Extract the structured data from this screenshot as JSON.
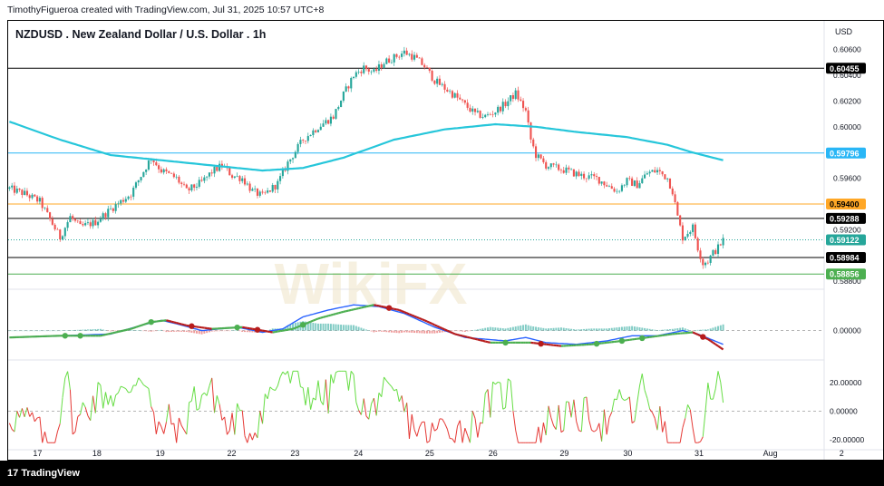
{
  "header": {
    "attribution": "TimothyFigueroa created with TradingView.com, Jul 31, 2025 10:57 UTC+8"
  },
  "chart_title": "NZDUSD . New Zealand Dollar / U.S. Dollar . 1h",
  "currency": "USD",
  "footer": {
    "brand": "TradingView",
    "brand_mark": "17"
  },
  "watermark": "WikiFX",
  "colors": {
    "up": "#26a69a",
    "down": "#ef5350",
    "ma": "#26c6da",
    "orange": "#ffa726",
    "black": "#000000",
    "green": "#4caf50",
    "macd_blue": "#2962ff",
    "macd_red": "#b71c1c",
    "rsi_green": "#66dd44",
    "rsi_red": "#e53935"
  },
  "chart_data": [
    {
      "type": "candlestick",
      "title": "NZDUSD . New Zealand Dollar / U.S. Dollar . 1h",
      "ylim": [
        0.5878,
        0.6064
      ],
      "x_ticks": [
        "17",
        "18",
        "19",
        "22",
        "23",
        "24",
        "25",
        "26",
        "29",
        "30",
        "31",
        "Aug",
        "2"
      ],
      "y_ticks": [
        "0.60600",
        "0.60400",
        "0.60200",
        "0.60000",
        "0.59800",
        "0.59600",
        "0.59400",
        "0.59200",
        "0.59000",
        "0.58800"
      ],
      "horizontal_lines": [
        {
          "value": 0.60455,
          "label": "0.60455",
          "color": "#000000",
          "style": "solid"
        },
        {
          "value": 0.59796,
          "label": "0.59796",
          "color": "#29b6f6",
          "style": "solid"
        },
        {
          "value": 0.594,
          "label": "0.59400",
          "color": "#ffa726",
          "style": "solid"
        },
        {
          "value": 0.59288,
          "label": "0.59288",
          "color": "#000000",
          "style": "solid"
        },
        {
          "value": 0.59122,
          "label": "0.59122",
          "color": "#26a69a",
          "style": "dotted"
        },
        {
          "value": 0.58984,
          "label": "0.58984",
          "color": "#000000",
          "style": "solid"
        },
        {
          "value": 0.58856,
          "label": "0.58856",
          "color": "#4caf50",
          "style": "solid"
        }
      ],
      "close_path": [
        [
          0,
          0.5952
        ],
        [
          6,
          0.5948
        ],
        [
          12,
          0.5942
        ],
        [
          16,
          0.5928
        ],
        [
          20,
          0.5914
        ],
        [
          24,
          0.593
        ],
        [
          28,
          0.5922
        ],
        [
          34,
          0.5926
        ],
        [
          40,
          0.5936
        ],
        [
          48,
          0.5948
        ],
        [
          52,
          0.5962
        ],
        [
          56,
          0.5976
        ],
        [
          60,
          0.5966
        ],
        [
          66,
          0.596
        ],
        [
          70,
          0.595
        ],
        [
          76,
          0.5957
        ],
        [
          80,
          0.5965
        ],
        [
          84,
          0.597
        ],
        [
          88,
          0.5962
        ],
        [
          92,
          0.596
        ],
        [
          96,
          0.595
        ],
        [
          100,
          0.5946
        ],
        [
          106,
          0.5956
        ],
        [
          110,
          0.5972
        ],
        [
          116,
          0.599
        ],
        [
          122,
          0.6
        ],
        [
          128,
          0.6008
        ],
        [
          132,
          0.6025
        ],
        [
          136,
          0.604
        ],
        [
          140,
          0.6046
        ],
        [
          144,
          0.6042
        ],
        [
          148,
          0.605
        ],
        [
          152,
          0.6054
        ],
        [
          156,
          0.6058
        ],
        [
          160,
          0.6054
        ],
        [
          164,
          0.6047
        ],
        [
          168,
          0.6036
        ],
        [
          172,
          0.603
        ],
        [
          176,
          0.6024
        ],
        [
          180,
          0.6017
        ],
        [
          184,
          0.601
        ],
        [
          188,
          0.6008
        ],
        [
          192,
          0.6012
        ],
        [
          196,
          0.6018
        ],
        [
          200,
          0.6026
        ],
        [
          204,
          0.6012
        ],
        [
          206,
          0.599
        ],
        [
          208,
          0.5978
        ],
        [
          212,
          0.597
        ],
        [
          216,
          0.5968
        ],
        [
          220,
          0.5966
        ],
        [
          226,
          0.5962
        ],
        [
          232,
          0.596
        ],
        [
          236,
          0.5955
        ],
        [
          240,
          0.595
        ],
        [
          244,
          0.5958
        ],
        [
          248,
          0.5955
        ],
        [
          252,
          0.5964
        ],
        [
          256,
          0.5966
        ],
        [
          260,
          0.596
        ],
        [
          262,
          0.595
        ],
        [
          264,
          0.593
        ],
        [
          266,
          0.5914
        ],
        [
          268,
          0.5918
        ],
        [
          270,
          0.5922
        ],
        [
          272,
          0.5906
        ],
        [
          274,
          0.5894
        ],
        [
          276,
          0.5896
        ],
        [
          278,
          0.5902
        ],
        [
          280,
          0.5906
        ],
        [
          282,
          0.5912
        ]
      ],
      "ma_path": [
        [
          0,
          0.6004
        ],
        [
          20,
          0.599
        ],
        [
          40,
          0.5978
        ],
        [
          60,
          0.5974
        ],
        [
          80,
          0.597
        ],
        [
          100,
          0.5966
        ],
        [
          116,
          0.5968
        ],
        [
          132,
          0.5976
        ],
        [
          152,
          0.599
        ],
        [
          172,
          0.5998
        ],
        [
          192,
          0.6002
        ],
        [
          208,
          0.6
        ],
        [
          224,
          0.5996
        ],
        [
          244,
          0.5992
        ],
        [
          260,
          0.5986
        ],
        [
          270,
          0.598
        ],
        [
          282,
          0.5974
        ]
      ],
      "n_bars": 283
    },
    {
      "type": "line",
      "name": "MACD",
      "ylim": [
        -0.0015,
        0.0022
      ],
      "y_ticks": [
        "0.00000"
      ],
      "series": [
        {
          "points": [
            [
              0,
              -0.0004
            ],
            [
              20,
              -0.0003
            ],
            [
              40,
              -0.0002
            ],
            [
              52,
              0.0003
            ],
            [
              60,
              0.0006
            ],
            [
              66,
              0.0004
            ],
            [
              76,
              0.0
            ],
            [
              90,
              0.0002
            ],
            [
              100,
              -0.0001
            ],
            [
              108,
              0.0001
            ],
            [
              116,
              0.0008
            ],
            [
              126,
              0.0012
            ],
            [
              136,
              0.0015
            ],
            [
              146,
              0.0014
            ],
            [
              156,
              0.001
            ],
            [
              168,
              0.0002
            ],
            [
              180,
              -0.0004
            ],
            [
              196,
              -0.0006
            ],
            [
              204,
              -0.0004
            ],
            [
              212,
              -0.0007
            ],
            [
              224,
              -0.0008
            ],
            [
              236,
              -0.0006
            ],
            [
              246,
              -0.0003
            ],
            [
              256,
              -0.0003
            ],
            [
              266,
              0.0
            ],
            [
              272,
              -0.0002
            ],
            [
              282,
              -0.0008
            ]
          ]
        },
        {
          "points": [
            [
              0,
              -0.0004
            ],
            [
              20,
              -0.0003
            ],
            [
              36,
              -0.0003
            ],
            [
              48,
              0.0001
            ],
            [
              56,
              0.0005
            ],
            [
              62,
              0.0006
            ],
            [
              70,
              0.0003
            ],
            [
              80,
              0.0001
            ],
            [
              92,
              0.0002
            ],
            [
              104,
              -0.0001
            ],
            [
              112,
              0.0001
            ],
            [
              122,
              0.0007
            ],
            [
              132,
              0.0011
            ],
            [
              144,
              0.0015
            ],
            [
              154,
              0.0012
            ],
            [
              164,
              0.0006
            ],
            [
              176,
              -0.0002
            ],
            [
              190,
              -0.0007
            ],
            [
              206,
              -0.0007
            ],
            [
              218,
              -0.0009
            ],
            [
              230,
              -0.0008
            ],
            [
              242,
              -0.0006
            ],
            [
              252,
              -0.0004
            ],
            [
              262,
              -0.0002
            ],
            [
              270,
              -0.0001
            ],
            [
              276,
              -0.0005
            ],
            [
              282,
              -0.0011
            ]
          ]
        }
      ],
      "signal_dots": [
        [
          22,
          -0.0002
        ],
        [
          28,
          -0.0002
        ],
        [
          56,
          0.0005
        ],
        [
          72,
          0.0002
        ],
        [
          90,
          0.0002
        ],
        [
          98,
          -0.0001
        ],
        [
          116,
          0.0007
        ],
        [
          150,
          0.0014
        ],
        [
          196,
          -0.0006
        ],
        [
          210,
          -0.0006
        ],
        [
          232,
          -0.0008
        ],
        [
          242,
          -0.0007
        ],
        [
          250,
          -0.0004
        ],
        [
          274,
          -0.0002
        ]
      ]
    },
    {
      "type": "line",
      "name": "Oscillator",
      "ylim": [
        -25,
        32
      ],
      "y_ticks": [
        "20.00000",
        "0.00000",
        "-20.00000"
      ],
      "values_seed": 283
    }
  ]
}
